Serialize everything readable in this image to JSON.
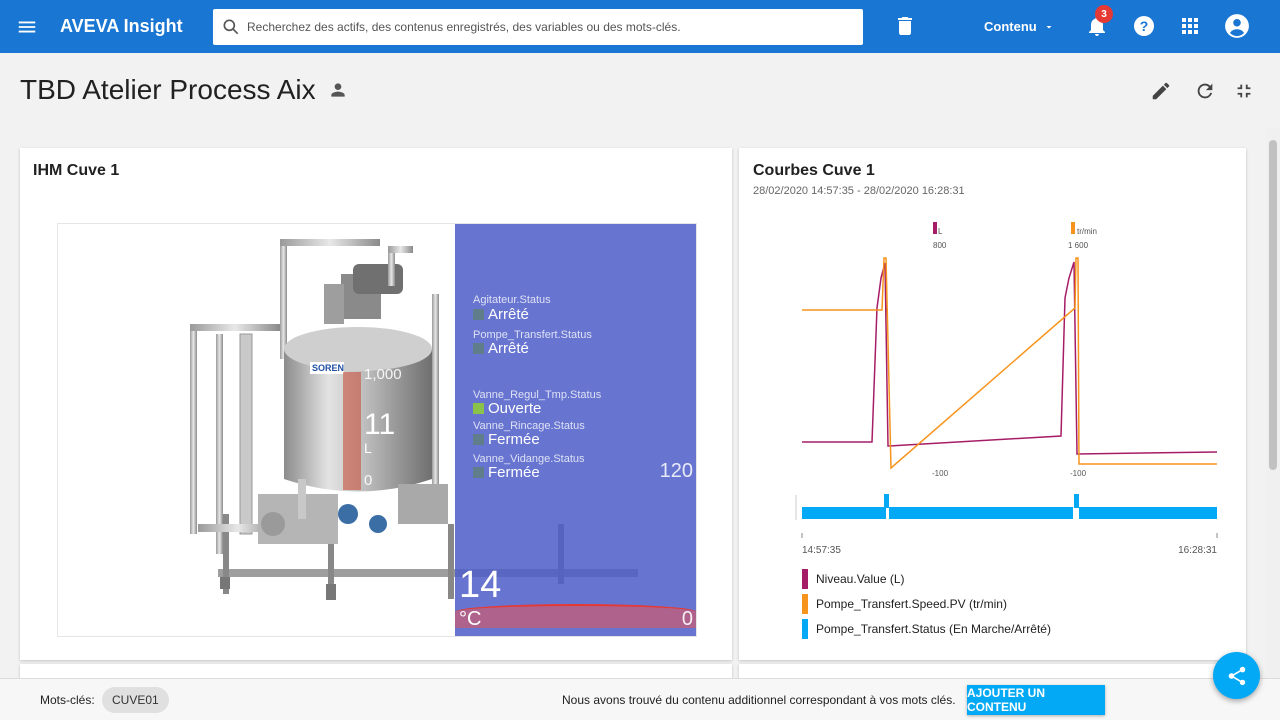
{
  "app": {
    "title": "AVEVA Insight"
  },
  "search": {
    "placeholder": "Recherchez des actifs, des contenus enregistrés, des variables ou des mots-clés."
  },
  "toolbar": {
    "content_label": "Contenu",
    "notification_count": "3"
  },
  "page": {
    "title": "TBD Atelier Process Aix"
  },
  "hmi_card": {
    "title": "IHM Cuve 1",
    "statuses": [
      {
        "label": "Agitateur.Status",
        "value": "Arrêté",
        "color": "#607d8b"
      },
      {
        "label": "Pompe_Transfert.Status",
        "value": "Arrêté",
        "color": "#607d8b"
      },
      {
        "label": "Vanne_Regul_Tmp.Status",
        "value": "Ouverte",
        "color": "#8bc34a"
      },
      {
        "label": "Vanne_Rincage.Status",
        "value": "Fermée",
        "color": "#607d8b"
      },
      {
        "label": "Vanne_Vidange.Status",
        "value": "Fermée",
        "color": "#607d8b"
      }
    ],
    "tank_brand": "SOREN",
    "level": {
      "max": "1,000",
      "value": "11",
      "unit": "L",
      "min": "0"
    },
    "temperature": {
      "value": "14",
      "unit": "°C",
      "max": "120",
      "min": "0"
    }
  },
  "chart_card": {
    "title": "Courbes Cuve 1",
    "range": "28/02/2020 14:57:35 - 28/02/2020 16:28:31",
    "chart_data": {
      "type": "line",
      "x_range": [
        "14:57:35",
        "16:28:31"
      ],
      "series": [
        {
          "name": "Niveau.Value (L)",
          "color": "#a61d67",
          "unit": "L",
          "scale_top": "800",
          "scale_bottom": "-100"
        },
        {
          "name": "Pompe_Transfert.Speed.PV (tr/min)",
          "color": "#f7941d",
          "unit": "tr/min",
          "scale_top": "1 600",
          "scale_bottom": "-100"
        },
        {
          "name": "Pompe_Transfert.Status (En Marche/Arrêté)",
          "color": "#03a9f4"
        }
      ]
    }
  },
  "footer": {
    "keywords_label": "Mots-clés:",
    "keyword_chip": "CUVE01",
    "message": "Nous avons trouvé du contenu additionnel correspondant à vos mots clés.",
    "add_button": "AJOUTER UN CONTENU"
  }
}
